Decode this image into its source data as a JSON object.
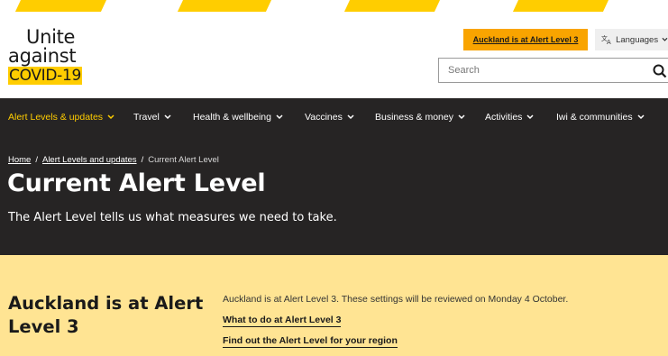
{
  "logo": {
    "line1": "Unite",
    "line2": "against",
    "line3": "COVID-19"
  },
  "header": {
    "alert_button": "Auckland is at Alert Level 3",
    "languages_label": "Languages",
    "search_placeholder": "Search"
  },
  "nav": {
    "items": [
      {
        "label": "Alert Levels & updates",
        "active": true
      },
      {
        "label": "Travel",
        "active": false
      },
      {
        "label": "Health & wellbeing",
        "active": false
      },
      {
        "label": "Vaccines",
        "active": false
      },
      {
        "label": "Business & money",
        "active": false
      },
      {
        "label": "Activities",
        "active": false
      },
      {
        "label": "Iwi & communities",
        "active": false
      }
    ]
  },
  "breadcrumb": {
    "home": "Home",
    "parent": "Alert Levels and updates",
    "current": "Current Alert Level",
    "separator": "/"
  },
  "hero": {
    "title": "Current Alert Level",
    "subtitle": "The Alert Level tells us what measures we need to take."
  },
  "alert_band": {
    "heading": "Auckland is at Alert Level 3",
    "description": "Auckland is at Alert Level 3. These settings will be reviewed on Monday 4 October.",
    "link1": "What to do at Alert Level 3",
    "link2": "Find out the Alert Level for your region"
  },
  "colors": {
    "brand_yellow": "#ffcd00",
    "alert_orange": "#f9a400",
    "dark_bg": "#262424",
    "band_bg": "#ffe493"
  }
}
